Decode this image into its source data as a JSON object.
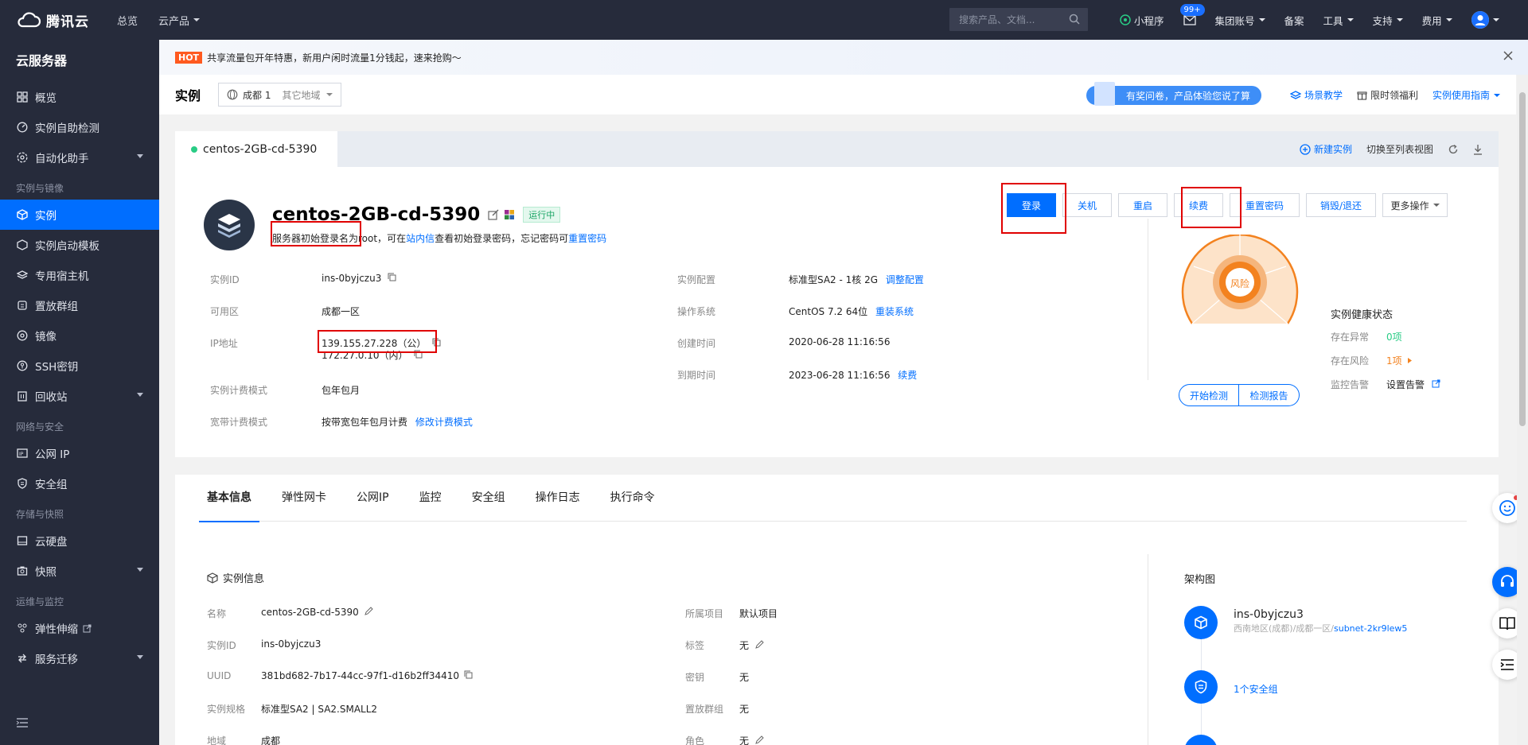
{
  "topbar": {
    "brand": "腾讯云",
    "nav": [
      "总览",
      "云产品"
    ],
    "search_placeholder": "搜索产品、文档...",
    "right": [
      "小程序",
      "集团账号",
      "备案",
      "工具",
      "支持",
      "费用"
    ],
    "badge": "99+"
  },
  "sidebar": {
    "title": "云服务器",
    "items": [
      {
        "label": "概览",
        "icon": "grid-icon"
      },
      {
        "label": "实例自助检测",
        "icon": "gauge-icon"
      },
      {
        "label": "自动化助手",
        "icon": "gear-icon",
        "chevron": true
      }
    ],
    "group1": "实例与镜像",
    "items1": [
      {
        "label": "实例",
        "icon": "cube-icon",
        "active": true
      },
      {
        "label": "实例启动模板",
        "icon": "template-icon"
      },
      {
        "label": "专用宿主机",
        "icon": "host-icon"
      },
      {
        "label": "置放群组",
        "icon": "placement-icon"
      },
      {
        "label": "镜像",
        "icon": "disc-icon"
      },
      {
        "label": "SSH密钥",
        "icon": "key-icon"
      },
      {
        "label": "回收站",
        "icon": "trash-icon",
        "chevron": true
      }
    ],
    "group2": "网络与安全",
    "items2": [
      {
        "label": "公网 IP",
        "icon": "ip-icon"
      },
      {
        "label": "安全组",
        "icon": "shield-icon"
      }
    ],
    "group3": "存储与快照",
    "items3": [
      {
        "label": "云硬盘",
        "icon": "disk-icon"
      },
      {
        "label": "快照",
        "icon": "camera-icon",
        "chevron": true
      }
    ],
    "group4": "运维与监控",
    "items4": [
      {
        "label": "弹性伸缩",
        "icon": "scale-icon",
        "external": true
      },
      {
        "label": "服务迁移",
        "icon": "migrate-icon",
        "chevron": true
      }
    ]
  },
  "notice": {
    "hot": "HOT",
    "text": "共享流量包开年特惠，新用户闲时流量1分钱起，速来抢购～"
  },
  "header": {
    "title": "实例",
    "region": "成都 1",
    "other_region": "其它地域",
    "survey": "有奖问卷，产品体验您说了算",
    "links": [
      "场景教学",
      "限时领福利",
      "实例使用指南"
    ]
  },
  "card1": {
    "tab": "centos-2GB-cd-5390",
    "tools": [
      "新建实例",
      "切换至列表视图"
    ],
    "name": "centos-2GB-cd-5390",
    "status": "运行中",
    "tip_prefix": "服务器初始登录名为root，",
    "tip_mid": "可在",
    "tip_link1": "站内信",
    "tip_mid2": "查看初始登录密码，忘记密码可",
    "tip_link2": "重置密码",
    "buttons": [
      "登录",
      "关机",
      "重启",
      "续费",
      "重置密码",
      "销毁/退还",
      "更多操作"
    ],
    "left_kv": [
      {
        "k": "实例ID",
        "v": "ins-0byjczu3"
      },
      {
        "k": "可用区",
        "v": "成都一区"
      },
      {
        "k": "IP地址",
        "v": "139.155.27.228（公）",
        "v2": "172.27.0.10（内）"
      },
      {
        "k": "实例计费模式",
        "v": "包年包月"
      },
      {
        "k": "宽带计费模式",
        "v": "按带宽包年包月计费",
        "link": "修改计费模式"
      }
    ],
    "mid_kv": [
      {
        "k": "实例配置",
        "v": "标准型SA2 - 1核 2G",
        "link": "调整配置"
      },
      {
        "k": "操作系统",
        "v": "CentOS 7.2 64位",
        "link": "重装系统"
      },
      {
        "k": "创建时间",
        "v": "2020-06-28 11:16:56"
      },
      {
        "k": "到期时间",
        "v": "2023-06-28 11:16:56",
        "link": "续费"
      }
    ],
    "health": {
      "gauge_label": "风险",
      "title": "实例健康状态",
      "rows": [
        {
          "k": "存在异常",
          "v": "0项"
        },
        {
          "k": "存在风险",
          "v": "1项"
        },
        {
          "k": "监控告警",
          "v": "设置告警"
        }
      ],
      "buttons": [
        "开始检测",
        "检测报告"
      ]
    }
  },
  "card2": {
    "tabs": [
      "基本信息",
      "弹性网卡",
      "公网IP",
      "监控",
      "安全组",
      "操作日志",
      "执行命令"
    ],
    "section": "实例信息",
    "left_kv": [
      {
        "k": "名称",
        "v": "centos-2GB-cd-5390"
      },
      {
        "k": "实例ID",
        "v": "ins-0byjczu3"
      },
      {
        "k": "UUID",
        "v": "381bd682-7b17-44cc-97f1-d16b2ff34410"
      },
      {
        "k": "实例规格",
        "v": "标准型SA2 | SA2.SMALL2"
      },
      {
        "k": "地域",
        "v": "成都"
      }
    ],
    "mid_kv": [
      {
        "k": "所属项目",
        "v": "默认项目"
      },
      {
        "k": "标签",
        "v": "无"
      },
      {
        "k": "密钥",
        "v": "无"
      },
      {
        "k": "置放群组",
        "v": "无"
      },
      {
        "k": "角色",
        "v": "无"
      }
    ],
    "arch_title": "架构图",
    "arch_inst": "ins-0byjczu3",
    "arch_region": "西南地区(成都)/成都一区/",
    "arch_subnet": "subnet-2kr9lew5",
    "arch_sg": "1个安全组"
  }
}
